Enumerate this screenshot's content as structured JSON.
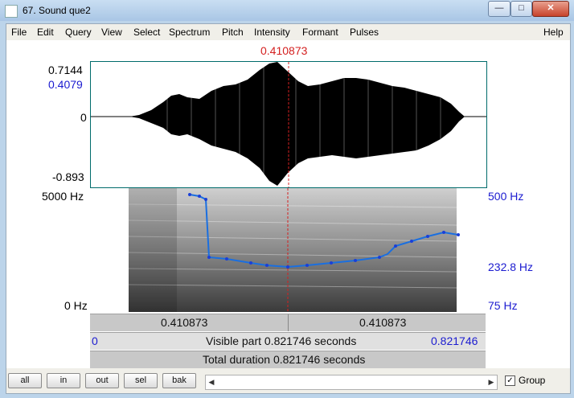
{
  "window": {
    "title": "67. Sound que2"
  },
  "menu": [
    "File",
    "Edit",
    "Query",
    "View",
    "Select",
    "Spectrum",
    "Pitch",
    "Intensity",
    "Formant",
    "Pulses"
  ],
  "help_label": "Help",
  "cursor_time": "0.410873",
  "waveform": {
    "max_label": "0.7144",
    "cursor_value": "0.4079",
    "zero_label": "0",
    "min_label": "-0.893"
  },
  "spectrogram": {
    "top_freq": "5000 Hz",
    "bottom_freq": "0 Hz"
  },
  "pitch_axis": {
    "top": "500 Hz",
    "mid": "232.8 Hz",
    "bottom": "75 Hz"
  },
  "selection_bar": {
    "left": "0.410873",
    "right": "0.410873"
  },
  "visible_bar": {
    "start": "0",
    "text": "Visible part 0.821746 seconds",
    "end": "0.821746"
  },
  "total_bar": {
    "text": "Total duration 0.821746 seconds"
  },
  "buttons": {
    "all": "all",
    "in": "in",
    "out": "out",
    "sel": "sel",
    "bak": "bak"
  },
  "group_label": "Group",
  "group_checked": true,
  "colors": {
    "pitch_line": "#1a6fe0",
    "cursor": "#d42020",
    "axis_blue": "#1b1bd0"
  }
}
